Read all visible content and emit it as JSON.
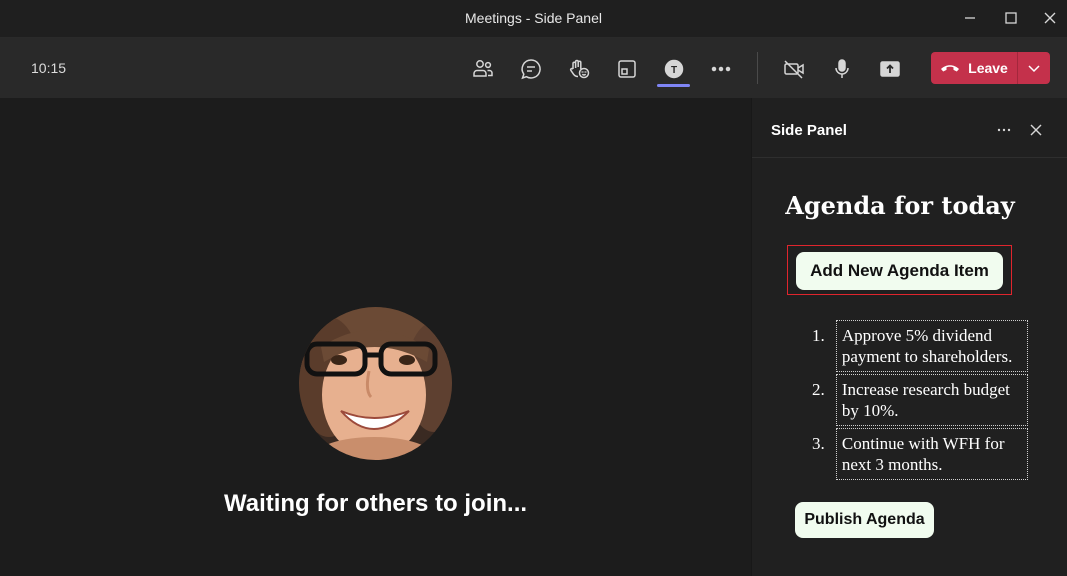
{
  "window": {
    "title": "Meetings - Side Panel"
  },
  "toolbar": {
    "time": "10:15",
    "icons": [
      "people-icon",
      "chat-icon",
      "raise-hand-icon",
      "share-tray-icon",
      "app-icon",
      "more-icon",
      "camera-off-icon",
      "mic-icon",
      "share-screen-icon"
    ],
    "leave_label": "Leave",
    "leave_color": "#c4314b",
    "active_indicator_color": "#7f85f5"
  },
  "stage": {
    "status_text": "Waiting for others to join..."
  },
  "side_panel": {
    "title": "Side Panel",
    "heading": "Agenda for today",
    "add_button_label": "Add New Agenda Item",
    "agenda_items": [
      {
        "number": "1.",
        "text": "Approve 5% dividend payment to shareholders."
      },
      {
        "number": "2.",
        "text": "Increase research budget by 10%."
      },
      {
        "number": "3.",
        "text": "Continue with WFH for next 3 months."
      }
    ],
    "publish_button_label": "Publish Agenda",
    "button_bg_color": "#f1fcef",
    "highlight_border_color": "#e0252d"
  }
}
